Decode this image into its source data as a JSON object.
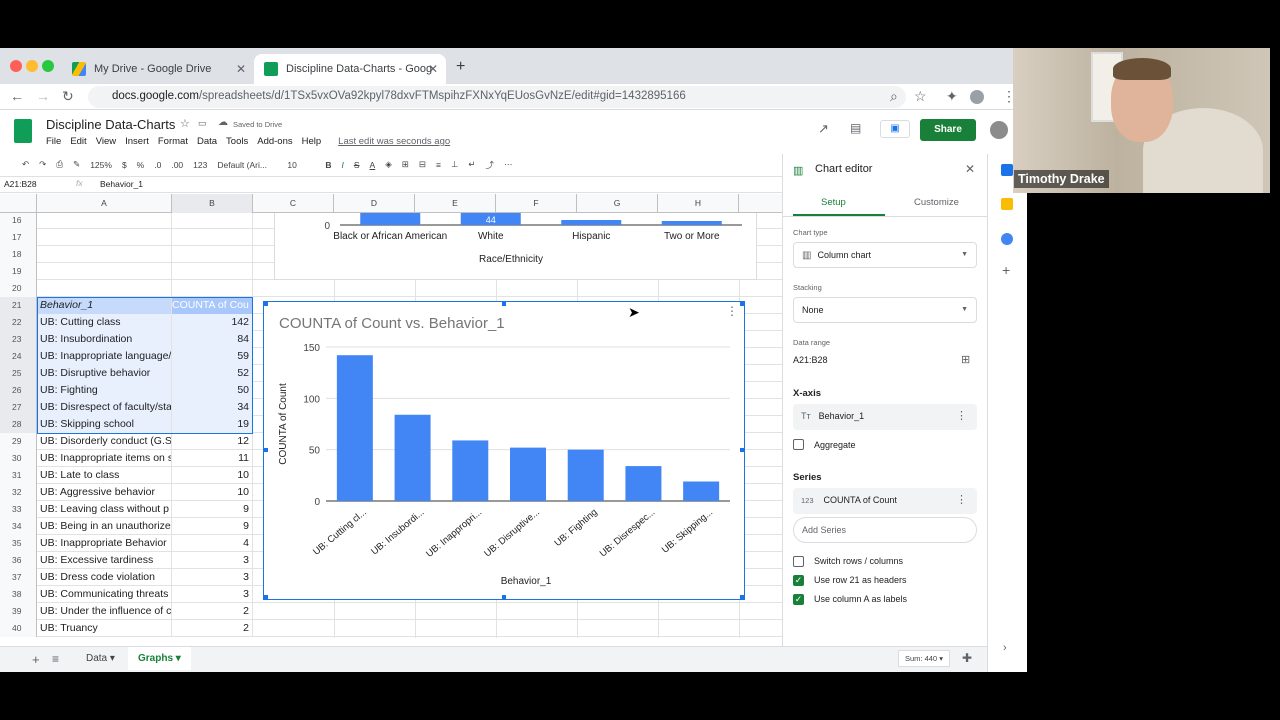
{
  "browser": {
    "tabs": [
      {
        "title": "My Drive - Google Drive"
      },
      {
        "title": "Discipline Data-Charts - Goog"
      }
    ],
    "url_domain": "docs.google.com",
    "url_path": "/spreadsheets/d/1TSx5vxOVa92kpyl78dxvFTMspihzFXNxYqEUosGvNzE/edit#gid=1432895166"
  },
  "app": {
    "title": "Discipline Data-Charts",
    "saved": "Saved to Drive",
    "menus": [
      "File",
      "Edit",
      "View",
      "Insert",
      "Format",
      "Data",
      "Tools",
      "Add-ons",
      "Help"
    ],
    "last_edit": "Last edit was seconds ago",
    "share": "Share"
  },
  "toolbar": {
    "zoom": "125%",
    "currency": "$",
    "percent": "%",
    "dec_less": ".0",
    "dec_more": ".00",
    "format": "123",
    "font": "Default (Ari...",
    "font_size": "10"
  },
  "formula": {
    "cell": "A21:B28",
    "content": "Behavior_1"
  },
  "columns": [
    "A",
    "B",
    "C",
    "D",
    "E",
    "F",
    "G",
    "H"
  ],
  "rows": [
    {
      "n": "16",
      "a": "",
      "b": ""
    },
    {
      "n": "17",
      "a": "",
      "b": ""
    },
    {
      "n": "18",
      "a": "",
      "b": ""
    },
    {
      "n": "19",
      "a": "",
      "b": ""
    },
    {
      "n": "20",
      "a": "",
      "b": ""
    },
    {
      "n": "21",
      "a": "Behavior_1",
      "b": "COUNTA of Cou"
    },
    {
      "n": "22",
      "a": "UB: Cutting class",
      "b": "142"
    },
    {
      "n": "23",
      "a": "UB: Insubordination",
      "b": "84"
    },
    {
      "n": "24",
      "a": "UB: Inappropriate language/",
      "b": "59"
    },
    {
      "n": "25",
      "a": "UB: Disruptive behavior",
      "b": "52"
    },
    {
      "n": "26",
      "a": "UB: Fighting",
      "b": "50"
    },
    {
      "n": "27",
      "a": "UB: Disrespect of faculty/sta",
      "b": "34"
    },
    {
      "n": "28",
      "a": "UB: Skipping school",
      "b": "19"
    },
    {
      "n": "29",
      "a": "UB: Disorderly conduct (G.S",
      "b": "12"
    },
    {
      "n": "30",
      "a": "UB: Inappropriate items on s",
      "b": "11"
    },
    {
      "n": "31",
      "a": "UB: Late to class",
      "b": "10"
    },
    {
      "n": "32",
      "a": "UB: Aggressive behavior",
      "b": "10"
    },
    {
      "n": "33",
      "a": "UB: Leaving class without p",
      "b": "9"
    },
    {
      "n": "34",
      "a": "UB: Being in an unauthorize",
      "b": "9"
    },
    {
      "n": "35",
      "a": "UB: Inappropriate Behavior",
      "b": "4"
    },
    {
      "n": "36",
      "a": "UB: Excessive tardiness",
      "b": "3"
    },
    {
      "n": "37",
      "a": "UB: Dress code violation",
      "b": "3"
    },
    {
      "n": "38",
      "a": "UB: Communicating threats",
      "b": "3"
    },
    {
      "n": "39",
      "a": "UB: Under the influence of c",
      "b": "2"
    },
    {
      "n": "40",
      "a": "UB: Truancy",
      "b": "2"
    }
  ],
  "chart_data": [
    {
      "type": "bar",
      "categories": [
        "Black or African American",
        "White",
        "Hispanic",
        "Two or More"
      ],
      "data_labels": [
        "",
        "44",
        "",
        ""
      ],
      "xlabel": "Race/Ethnicity",
      "y_tick": "0"
    },
    {
      "type": "bar",
      "title": "COUNTA of Count vs. Behavior_1",
      "categories": [
        "UB: Cutting cl...",
        "UB: Insubordi...",
        "UB: Inappropri...",
        "UB: Disruptive...",
        "UB: Fighting",
        "UB: Disrespec...",
        "UB: Skipping..."
      ],
      "values": [
        142,
        84,
        59,
        52,
        50,
        34,
        19
      ],
      "xlabel": "Behavior_1",
      "ylabel": "COUNTA of Count",
      "ylim": [
        0,
        150
      ],
      "yticks": [
        "0",
        "50",
        "100",
        "150"
      ],
      "grid": true,
      "color": "#4285f4"
    }
  ],
  "editor": {
    "title": "Chart editor",
    "tabs": [
      "Setup",
      "Customize"
    ],
    "chart_type_label": "Chart type",
    "chart_type": "Column chart",
    "stacking_label": "Stacking",
    "stacking": "None",
    "range_label": "Data range",
    "range": "A21:B28",
    "xaxis_label": "X-axis",
    "xaxis": "Behavior_1",
    "aggregate": "Aggregate",
    "series_label": "Series",
    "series": "COUNTA of Count",
    "add_series": "Add Series",
    "switch": "Switch rows / columns",
    "headers": "Use row 21 as headers",
    "labels": "Use column A as labels"
  },
  "sheets": {
    "tabs": [
      "Data",
      "Graphs"
    ],
    "sum": "Sum: 440"
  },
  "video": {
    "name": "Timothy Drake"
  },
  "colors": {
    "accent": "#1a73e8",
    "green": "#188038",
    "bar": "#4285f4",
    "selection": "#e8f0fe"
  }
}
